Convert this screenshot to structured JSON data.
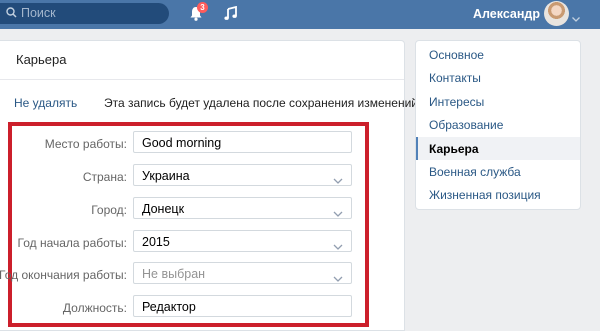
{
  "topbar": {
    "search_placeholder": "Поиск",
    "notifications_count": "3",
    "user_name": "Александр"
  },
  "card": {
    "title": "Карьера",
    "delete_link": "Не удалять",
    "delete_notice": "Эта запись будет удалена после сохранения изменений."
  },
  "form": {
    "fields": [
      {
        "label": "Место работы:",
        "value": "Good morning",
        "type": "text"
      },
      {
        "label": "Страна:",
        "value": "Украина",
        "type": "select"
      },
      {
        "label": "Город:",
        "value": "Донецк",
        "type": "select"
      },
      {
        "label": "Год начала работы:",
        "value": "2015",
        "type": "select"
      },
      {
        "label": "Год окончания работы:",
        "value": "Не выбран",
        "type": "select"
      },
      {
        "label": "Должность:",
        "value": "Редактор",
        "type": "text"
      }
    ]
  },
  "side_menu": {
    "items": [
      {
        "label": "Основное"
      },
      {
        "label": "Контакты"
      },
      {
        "label": "Интересы"
      },
      {
        "label": "Образование"
      },
      {
        "label": "Карьера",
        "active": true
      },
      {
        "label": "Военная служба"
      },
      {
        "label": "Жизненная позиция"
      }
    ]
  },
  "colors": {
    "header": "#4a76a8",
    "link": "#2a5885",
    "highlight_frame": "#cc1f2b"
  }
}
